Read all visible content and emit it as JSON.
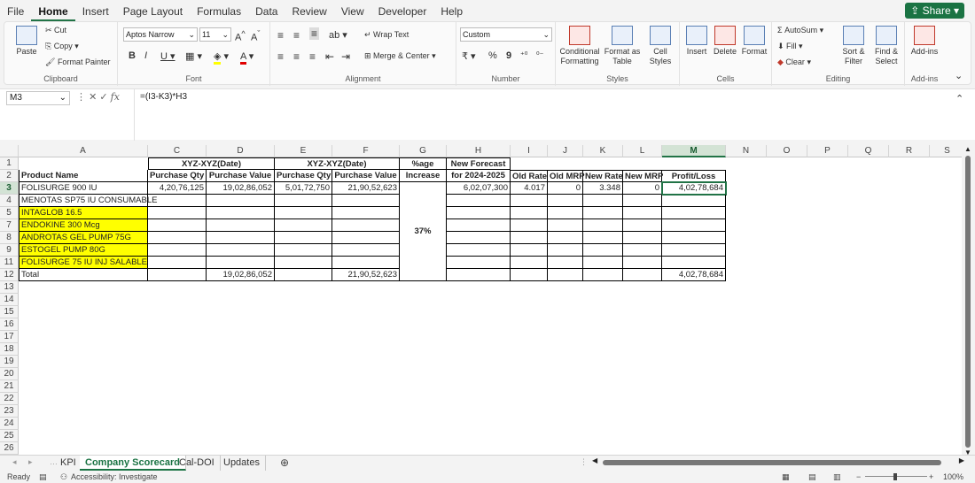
{
  "menu": {
    "tabs": [
      "File",
      "Home",
      "Insert",
      "Page Layout",
      "Formulas",
      "Data",
      "Review",
      "View",
      "Developer",
      "Help"
    ],
    "share": "Share"
  },
  "ribbon": {
    "clipboard": {
      "paste": "Paste",
      "cut": "Cut",
      "copy": "Copy",
      "format_painter": "Format Painter",
      "label": "Clipboard"
    },
    "font": {
      "name": "Aptos Narrow",
      "size": "11",
      "bold": "B",
      "italic": "I",
      "underline": "U",
      "grow": "A^",
      "shrink": "Aˇ",
      "label": "Font",
      "fill_color": "#ffff00",
      "font_color": "#e00000"
    },
    "alignment": {
      "wrap": "Wrap Text",
      "merge": "Merge & Center",
      "label": "Alignment"
    },
    "number": {
      "format": "Custom",
      "currency": "₹",
      "percent": "%",
      "comma": "9",
      "label": "Number"
    },
    "styles": {
      "conditional": "Conditional Formatting",
      "table": "Format as Table",
      "cell": "Cell Styles",
      "label": "Styles"
    },
    "cells": {
      "insert": "Insert",
      "delete": "Delete",
      "format": "Format",
      "label": "Cells"
    },
    "editing": {
      "autosum": "AutoSum",
      "fill": "Fill",
      "clear": "Clear",
      "sort": "Sort & Filter",
      "find": "Find & Select",
      "label": "Editing"
    },
    "addins": {
      "addins": "Add-ins",
      "label": "Add-ins"
    }
  },
  "formula_bar": {
    "name_box": "M3",
    "fx": "fx",
    "formula": "=(I3-K3)*H3"
  },
  "columns": [
    "A",
    "C",
    "D",
    "E",
    "F",
    "G",
    "H",
    "I",
    "J",
    "K",
    "L",
    "M",
    "N",
    "O",
    "P",
    "Q",
    "R",
    "S"
  ],
  "rows": [
    "1",
    "2",
    "3",
    "4",
    "5",
    "7",
    "8",
    "9",
    "11",
    "12",
    "13",
    "14",
    "15",
    "16",
    "17",
    "18",
    "19",
    "20",
    "21",
    "22",
    "23",
    "24",
    "25",
    "26",
    "27"
  ],
  "grid": {
    "c1": "XYZ-XYZ(Date)",
    "e1": "XYZ-XYZ(Date)",
    "g1": "%age",
    "h1": "New Forecast",
    "a2": "Product Name",
    "c2": "Purchase Qty",
    "d2": "Purchase Value",
    "e2": "Purchase Qty",
    "f2": "Purchase Value",
    "g2": "Increase",
    "h2": "for 2024-2025",
    "i2": "Old Rate",
    "j2": "Old MRP",
    "k2": "New Rate",
    "l2": "New MRP",
    "m2": "Profit/Loss",
    "a3": "FOLISURGE 900 IU",
    "c3": "4,20,76,125",
    "d3": "19,02,86,052",
    "e3": "5,01,72,750",
    "f3": "21,90,52,623",
    "h3": "6,02,07,300",
    "i3": "4.017",
    "j3": "0",
    "k3": "3.348",
    "l3": "0",
    "m3": "4,02,78,684",
    "a4": "MENOTAS SP75 IU CONSUMABLE",
    "a5": "INTAGLOB 16.5",
    "a7": "ENDOKINE 300 Mcg",
    "a8": "ANDROTAS GEL PUMP 75G",
    "a9": "ESTOGEL PUMP 80G",
    "a11": "FOLISURGE 75 IU INJ SALABLE",
    "a12": "Total",
    "d12": "19,02,86,052",
    "f12": "21,90,52,623",
    "g_merged": "37%",
    "m12": "4,02,78,684"
  },
  "sheet_tabs": [
    "KPI",
    "Company Scorecard",
    "Cal-DOI",
    "Updates"
  ],
  "status": {
    "ready": "Ready",
    "accessibility": "Accessibility: Investigate",
    "zoom": "100%"
  }
}
